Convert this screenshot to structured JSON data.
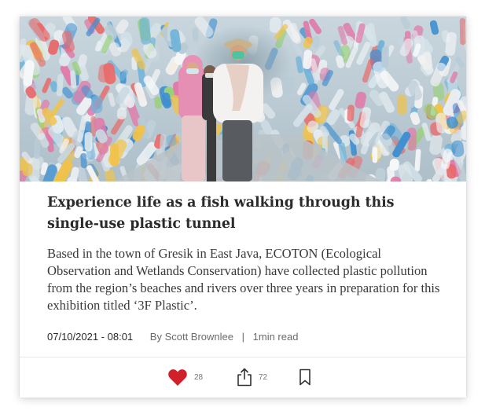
{
  "article": {
    "image_alt": "Visitors wearing masks walk through a tunnel built from thousands of plastic bottles",
    "headline": "Experience life as a fish walking through this single-use plastic tunnel",
    "summary": "Based in the town of Gresik in East Java, ECOTON (Ecological Observation and Wetlands Conservation) have collected plastic pollution from the region’s beaches and rivers over three years in preparation for this exhibition titled ‘3F Plastic’.",
    "date": "07/10/2021 - 08:01",
    "author": "By Scott Brownlee",
    "separator": "|",
    "read_time": "1min read"
  },
  "actions": {
    "like_count": "28",
    "share_count": "72",
    "like_icon": "heart-icon",
    "share_icon": "share-icon",
    "bookmark_icon": "bookmark-icon"
  },
  "colors": {
    "heart": "#d0202a",
    "headline": "#2b2b2b",
    "meta_muted": "#6b6b6b"
  }
}
